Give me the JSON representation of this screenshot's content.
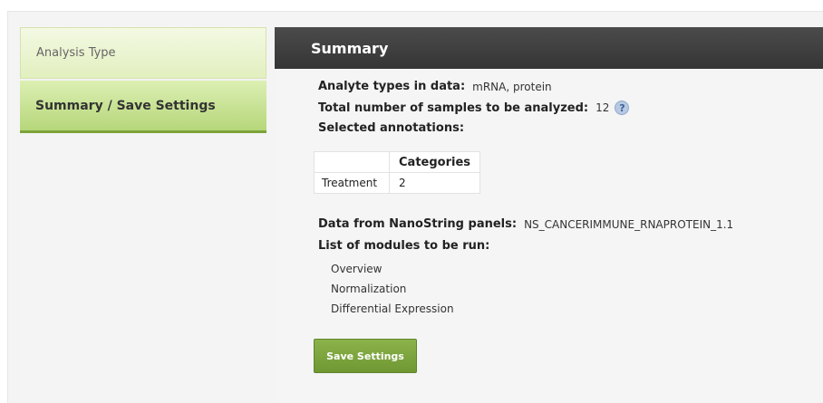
{
  "sidebar": {
    "items": [
      {
        "label": "Analysis Type",
        "active": false
      },
      {
        "label": "Summary / Save Settings",
        "active": true
      }
    ]
  },
  "panel": {
    "title": "Summary"
  },
  "summary": {
    "analyte_label": "Analyte types in data:",
    "analyte_value": "mRNA, protein",
    "samples_label": "Total number of samples to be analyzed:",
    "samples_value": "12",
    "help_glyph": "?",
    "annotations_label": "Selected annotations:",
    "annotations_table": {
      "headers": [
        "",
        "Categories"
      ],
      "rows": [
        [
          "Treatment",
          "2"
        ]
      ]
    },
    "panels_label": "Data from NanoString panels:",
    "panels_value": "NS_CANCERIMMUNE_RNAPROTEIN_1.1",
    "modules_label": "List of modules to be run:",
    "modules": [
      "Overview",
      "Normalization",
      "Differential Expression"
    ]
  },
  "save_button": {
    "label": "Save Settings"
  },
  "colors": {
    "accent_green": "#7da33a",
    "button_green": "#7ba43c",
    "header_dark": "#3f3f3f",
    "help_blue": "#b7c9e3"
  },
  "icons": {
    "help": "question-circle-icon"
  }
}
